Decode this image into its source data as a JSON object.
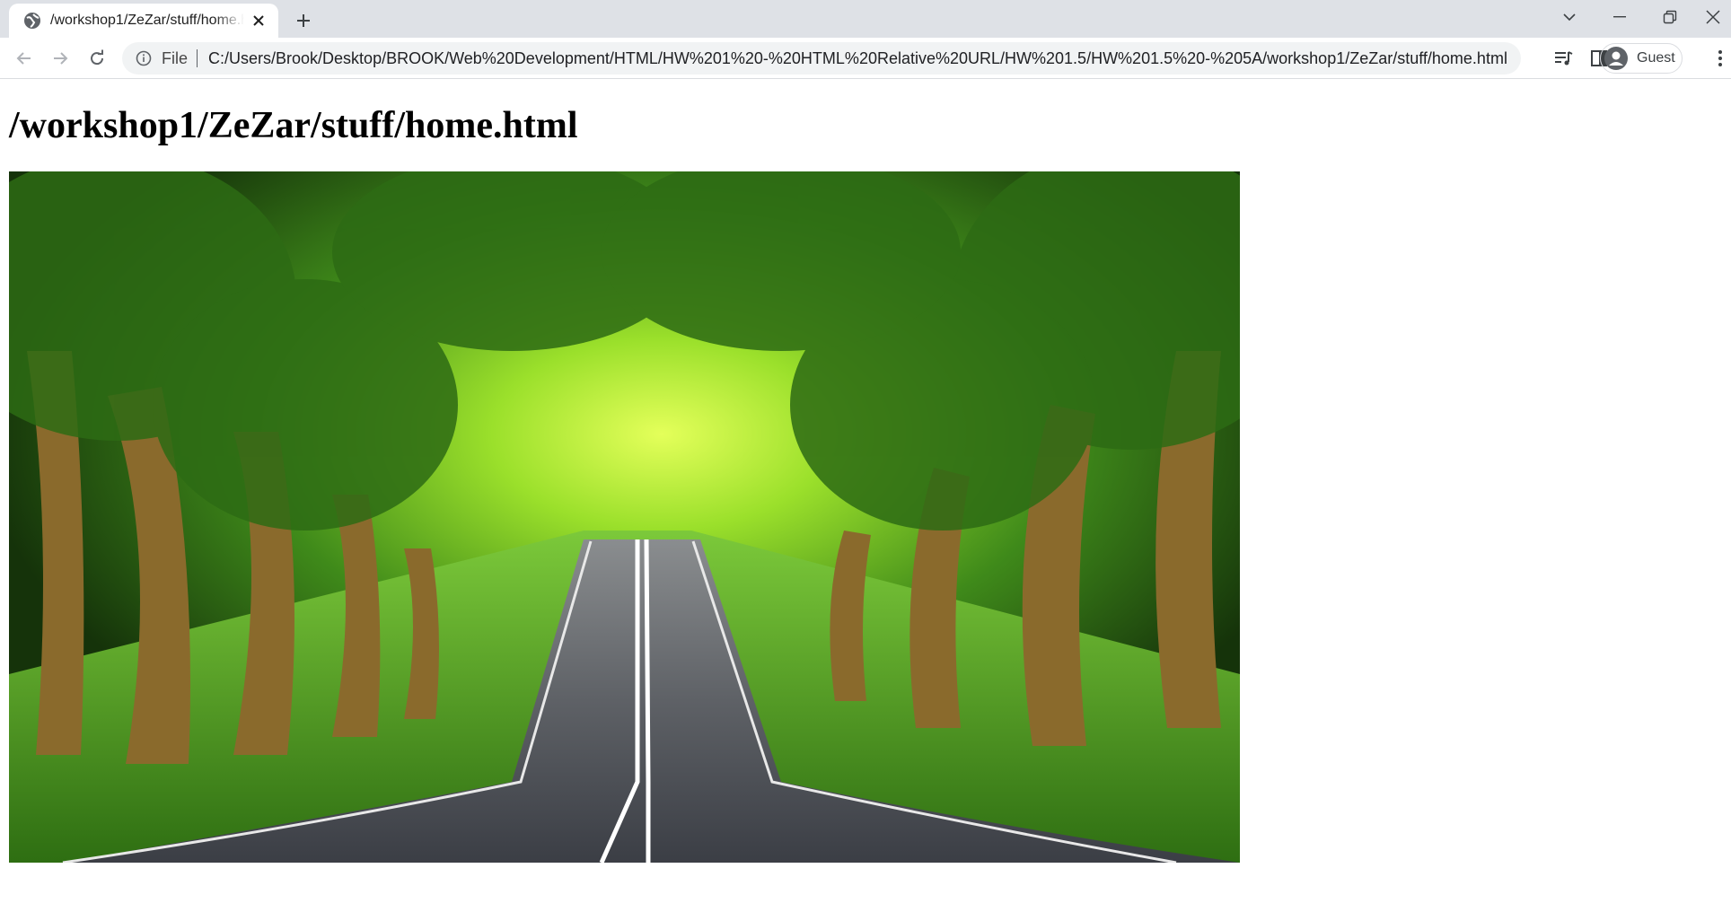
{
  "browser": {
    "tab": {
      "title": "/workshop1/ZeZar/stuff/home.html",
      "favicon": "globe-icon"
    },
    "address_bar": {
      "scheme_chip": "File",
      "url": "C:/Users/Brook/Desktop/BROOK/Web%20Development/HTML/HW%201%20-%20HTML%20Relative%20URL/HW%201.5/HW%201.5%20-%205A/workshop1/ZeZar/stuff/home.html"
    },
    "profile": {
      "label": "Guest"
    }
  },
  "page": {
    "heading": "/workshop1/ZeZar/stuff/home.html",
    "image": {
      "subject": "tree-lined country road"
    }
  },
  "colors": {
    "tabstrip": "#dee1e6",
    "omnibox": "#f1f3f4",
    "icon": "#5f6368",
    "foliage": "#3f8a1a",
    "road": "#4a4d55"
  }
}
